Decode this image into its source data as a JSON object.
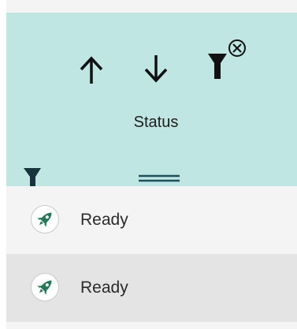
{
  "header": {
    "column_title": "Status",
    "sort_ascending_icon": "arrow-up-icon",
    "sort_descending_icon": "arrow-down-icon",
    "clear_filter_icon": "filter-clear-icon",
    "filter_icon": "filter-icon",
    "drag_handle_icon": "drag-handle-icon",
    "background_color": "#bfe6e2"
  },
  "rows": [
    {
      "status_icon": "rocket-icon",
      "label": "Ready"
    },
    {
      "status_icon": "rocket-icon",
      "label": "Ready"
    }
  ],
  "colors": {
    "icon_dark": "#0f1f1f",
    "rocket_green": "#1f7a55",
    "row_alt": "#e4e4e4"
  }
}
